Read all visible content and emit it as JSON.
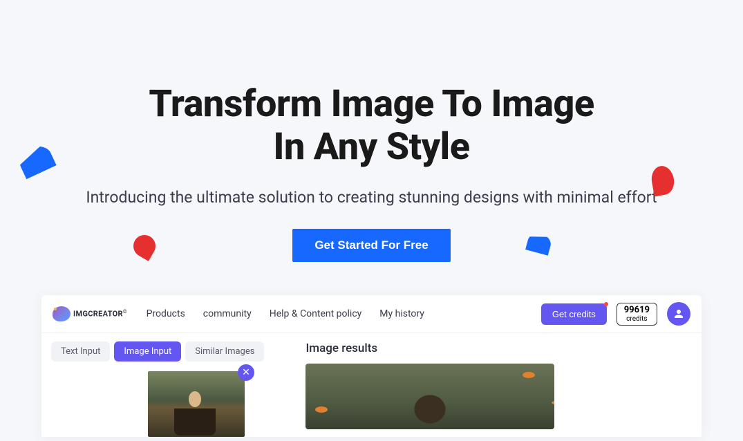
{
  "hero": {
    "title_line1": "Transform Image To Image",
    "title_line2": "In Any Style",
    "subtitle": "Introducing the ultimate solution to creating stunning designs with minimal effort",
    "cta_label": "Get Started For Free"
  },
  "app": {
    "logo_text": "IMGCREATOR",
    "logo_sup": "©",
    "nav": [
      {
        "label": "Products"
      },
      {
        "label": "community"
      },
      {
        "label": "Help & Content policy"
      },
      {
        "label": "My history"
      }
    ],
    "get_credits_label": "Get credits",
    "credits": {
      "count": "99619",
      "label": "credits"
    },
    "tabs": [
      {
        "label": "Text Input",
        "active": false
      },
      {
        "label": "Image Input",
        "active": true
      },
      {
        "label": "Similar Images",
        "active": false
      }
    ],
    "results_title": "Image results",
    "close_icon": "✕"
  }
}
